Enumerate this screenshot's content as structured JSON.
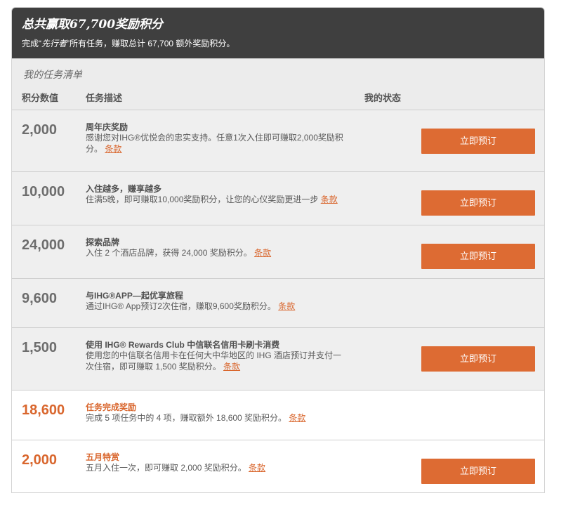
{
  "header": {
    "title": "总共赢取67,700奖励积分",
    "subtitle_pre": "完成“",
    "subtitle_hl": "先行者",
    "subtitle_post": "”所有任务，赚取总计 67,700 额外奖励积分。"
  },
  "list": {
    "title": "我的任务清单",
    "col_points": "积分数值",
    "col_desc": "任务描述",
    "col_status": "我的状态"
  },
  "terms_label": "条款",
  "book_label": "立即预订",
  "tasks": [
    {
      "points": "2,000",
      "title": "周年庆奖励",
      "desc": "感谢您对IHG®优悦会的忠实支持。任意1次入住即可赚取2,000奖励积分。"
    },
    {
      "points": "10,000",
      "title": "入住越多，赚享越多",
      "desc": "住满5晚，即可赚取10,000奖励积分，让您的心仪奖励更进一步"
    },
    {
      "points": "24,000",
      "title": "探索品牌",
      "desc": "入住 2 个酒店品牌，获得 24,000 奖励积分。"
    },
    {
      "points": "9,600",
      "title": "与IHG®APP—起优享旅程",
      "desc": "通过IHG® App预订2次住宿，赚取9,600奖励积分。"
    },
    {
      "points": "1,500",
      "title": "使用 IHG® Rewards Club 中信联名信用卡刷卡消费",
      "desc": "使用您的中信联名信用卡在任何大中华地区的 IHG 酒店预订并支付一次住宿，即可赚取 1,500 奖励积分。"
    },
    {
      "points": "18,600",
      "title": "任务完成奖励",
      "desc": "完成 5 项任务中的 4 项，赚取额外 18,600 奖励积分。"
    },
    {
      "points": "2,000",
      "title": "五月特赏",
      "desc": "五月入住一次，即可赚取 2,000 奖励积分。"
    }
  ],
  "colors": {
    "accent": "#dd6b33",
    "header_bg": "#3f3f3f",
    "row_grey": "#efefef"
  }
}
